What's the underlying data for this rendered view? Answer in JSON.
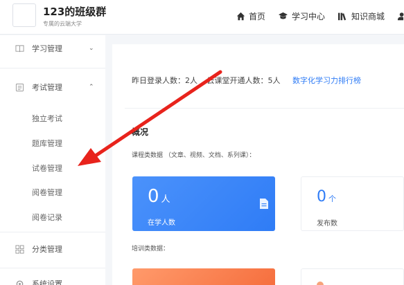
{
  "header": {
    "title": "123的班级群",
    "subtitle": "专属的云端大学",
    "nav": [
      {
        "label": "首页",
        "icon": "home-icon"
      },
      {
        "label": "学习中心",
        "icon": "graduation-cap-icon"
      },
      {
        "label": "知识商城",
        "icon": "books-icon"
      }
    ]
  },
  "sidebar": {
    "groups": [
      {
        "label": "学习管理",
        "icon": "book-icon",
        "state": "collapsed"
      },
      {
        "label": "考试管理",
        "icon": "exam-icon",
        "state": "expanded"
      },
      {
        "label": "分类管理",
        "icon": "grid-icon"
      },
      {
        "label": "系统设置",
        "icon": "gear-icon"
      }
    ],
    "exam_items": [
      "独立考试",
      "题库管理",
      "试卷管理",
      "阅卷管理",
      "阅卷记录"
    ]
  },
  "main": {
    "stats": {
      "login_label": "昨日登录人数：",
      "login_value": "2人",
      "cloud_label": "云课堂开通人数：",
      "cloud_value": "5人",
      "rank_link": "数字化学习力排行榜"
    },
    "overview_title": "概况",
    "course_caption": "课程类数据 （文章、视频、文档、系列课）：",
    "cards": [
      {
        "value": "0",
        "unit": "人",
        "label": "在学人数"
      },
      {
        "value": "0",
        "unit": "个",
        "label": "发布数"
      }
    ],
    "train_caption": "培训类数据："
  },
  "colors": {
    "accent": "#2f7cf6",
    "orange": "#f56c3b",
    "arrow": "#e8231c"
  }
}
